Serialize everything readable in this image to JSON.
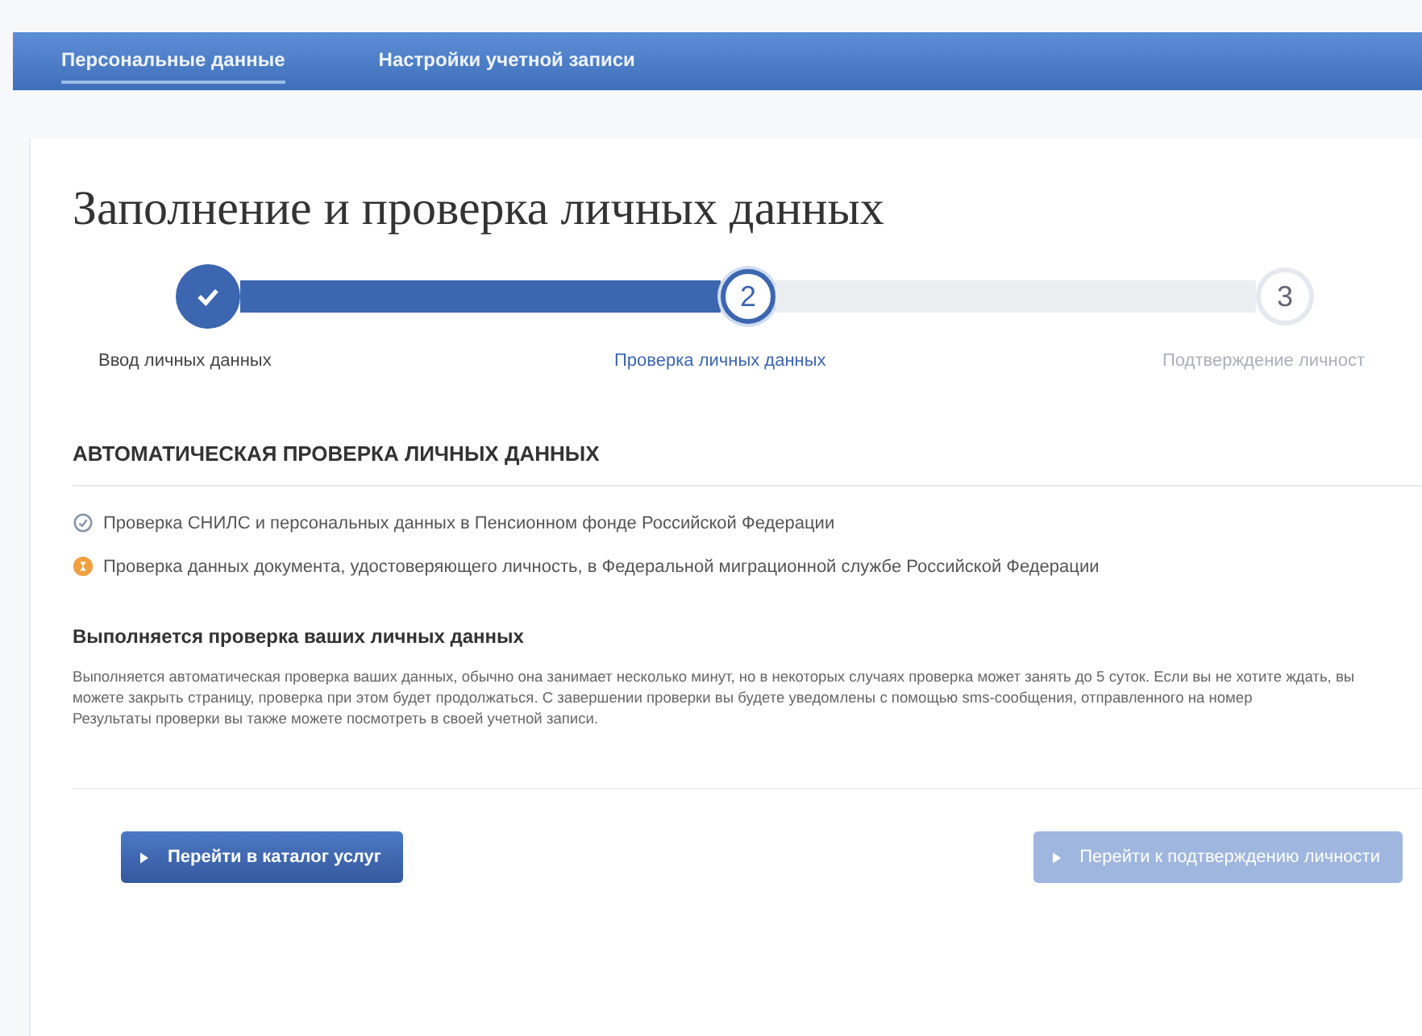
{
  "nav": {
    "tabs": [
      {
        "label": "Персональные данные",
        "selected": true
      },
      {
        "label": "Настройки учетной записи",
        "selected": false
      }
    ]
  },
  "page_title": "Заполнение и проверка личных данных",
  "steps": [
    {
      "label": "Ввод личных данных",
      "completed": true,
      "selected": false
    },
    {
      "number": "2",
      "label": "Проверка личных данных",
      "completed": false,
      "selected": true
    },
    {
      "number": "3",
      "label": "Подтверждение личност",
      "completed": false,
      "selected": false
    }
  ],
  "section_title": "АВТОМАТИЧЕСКАЯ ПРОВЕРКА ЛИЧНЫХ ДАННЫХ",
  "checks": [
    {
      "text": "Проверка СНИЛС и персональных данных в Пенсионном фонде Российской Федерации",
      "done": true
    },
    {
      "text": "Проверка данных документа, удостоверяющего личность, в Федеральной миграционной службе Российской Федерации",
      "done": false
    }
  ],
  "notice": {
    "title": "Выполняется проверка ваших личных данных",
    "text": "Выполняется автоматическая проверка ваших данных, обычно она занимает несколько минут, но в некоторых случаях проверка может занять до 5 суток. Если вы не хотите ждать, вы можете закрыть страницу, проверка при этом будет продолжаться. С завершении проверки вы будете уведомлены с помощью sms-сообщения, отправленного на номер                                   Результаты проверки вы также можете посмотреть в своей учетной записи."
  },
  "buttons": [
    {
      "label": "Перейти в каталог услуг",
      "disabled": false
    },
    {
      "label": "Перейти к подтверждению личности",
      "disabled": true
    }
  ]
}
